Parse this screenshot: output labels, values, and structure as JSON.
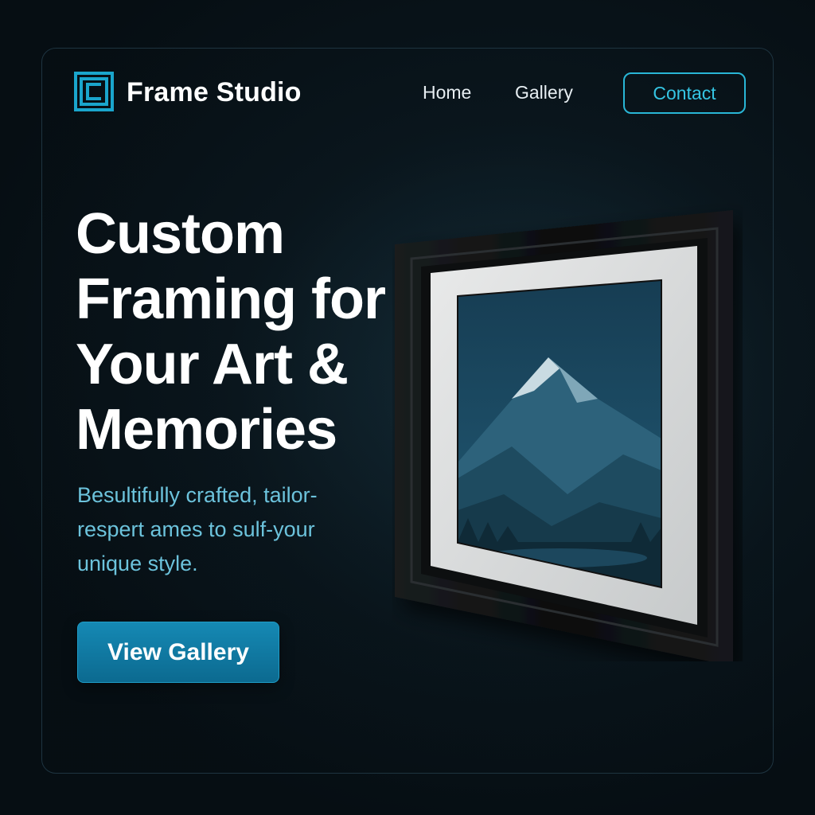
{
  "brand": {
    "name": "Frame Studio",
    "logo_icon": "frame-logo-icon",
    "accent_color": "#29b6d6"
  },
  "nav": {
    "home": "Home",
    "gallery": "Gallery",
    "contact": "Contact"
  },
  "hero": {
    "title_lines": [
      "Custom",
      "Framing for",
      "Your Art &",
      "Memories"
    ],
    "subtitle_lines": [
      "Besultifully crafted, tailor-",
      "respert ames to sulf-your",
      "unique style."
    ],
    "cta_label": "View Gallery"
  },
  "artwork": {
    "subject": "mountain-landscape-image"
  }
}
